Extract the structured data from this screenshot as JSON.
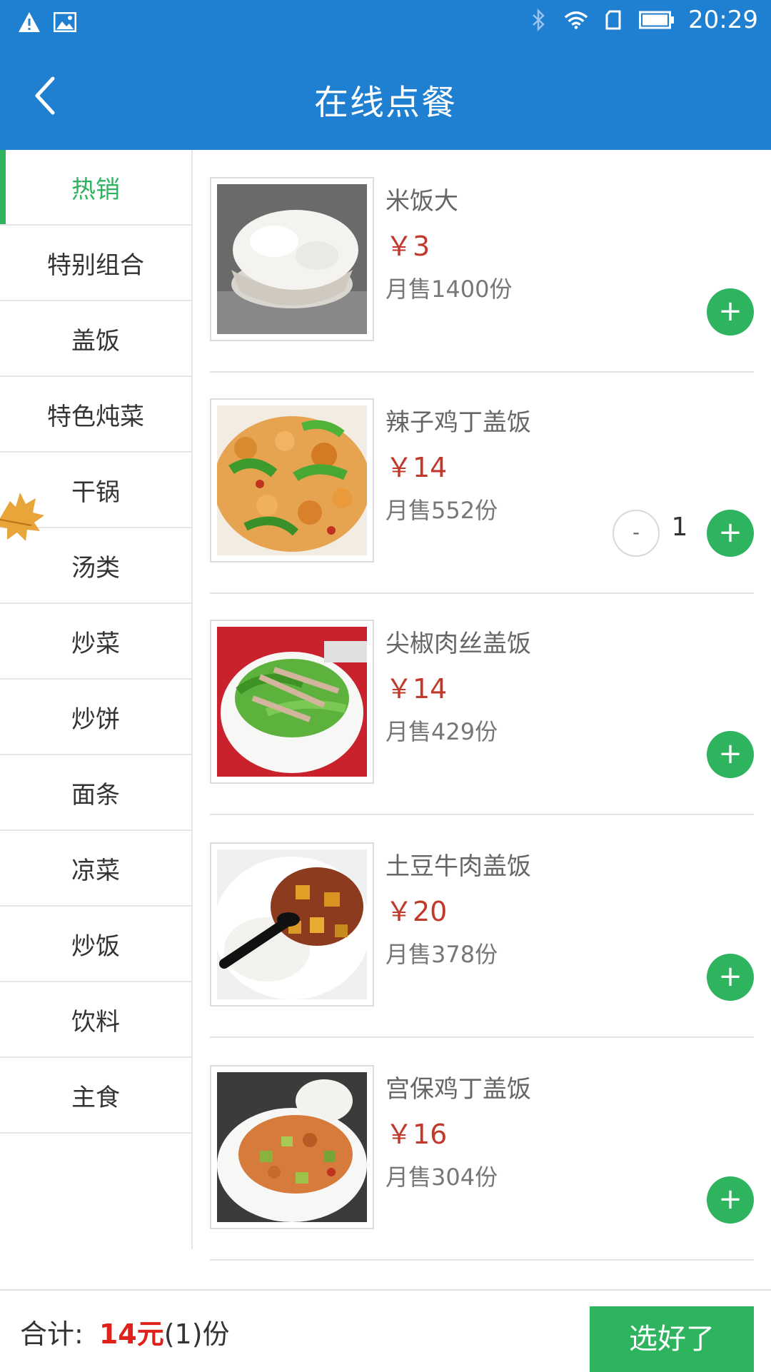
{
  "status_bar": {
    "time": "20:29",
    "left_icons": [
      "warning-icon",
      "image-icon"
    ],
    "right_icons": [
      "bluetooth-icon",
      "wifi-icon",
      "sim-icon",
      "battery-icon"
    ]
  },
  "header": {
    "title": "在线点餐",
    "back_icon": "chevron-left-icon",
    "background": "#1f7fd0"
  },
  "sidebar": {
    "active_color": "#2eb35f",
    "items": [
      {
        "label": "热销"
      },
      {
        "label": "特别组合"
      },
      {
        "label": "盖饭"
      },
      {
        "label": "特色炖菜"
      },
      {
        "label": "干锅"
      },
      {
        "label": "汤类"
      },
      {
        "label": "炒菜"
      },
      {
        "label": "炒饼"
      },
      {
        "label": "面条"
      },
      {
        "label": "凉菜"
      },
      {
        "label": "炒饭"
      },
      {
        "label": "饮料"
      },
      {
        "label": "主食"
      }
    ]
  },
  "menu": {
    "items": [
      {
        "name": "米饭大",
        "price": "￥3",
        "sold": "月售1400份",
        "add": "+"
      },
      {
        "name": "辣子鸡丁盖饭",
        "price": "￥14",
        "sold": "月售552份",
        "add": "+",
        "minus": "-",
        "qty": "1"
      },
      {
        "name": "尖椒肉丝盖饭",
        "price": "￥14",
        "sold": "月售429份",
        "add": "+"
      },
      {
        "name": "土豆牛肉盖饭",
        "price": "￥20",
        "sold": "月售378份",
        "add": "+"
      },
      {
        "name": "宫保鸡丁盖饭",
        "price": "￥16",
        "sold": "月售304份",
        "add": "+"
      }
    ]
  },
  "footer": {
    "total_label": "合计:",
    "total_amount": "14元",
    "total_count": "(1)份",
    "confirm_label": "选好了"
  }
}
